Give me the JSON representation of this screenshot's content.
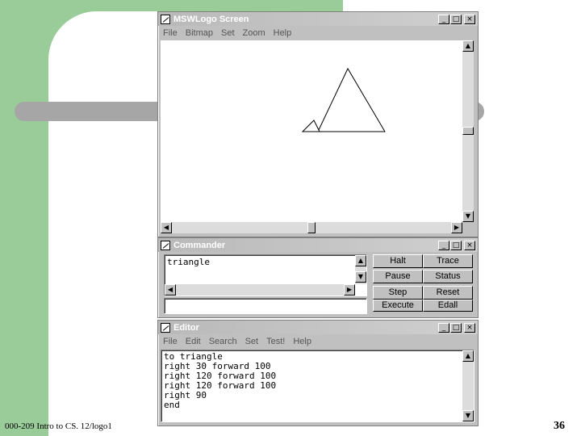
{
  "screen": {
    "title": "MSWLogo Screen",
    "menu": [
      "File",
      "Bitmap",
      "Set",
      "Zoom",
      "Help"
    ]
  },
  "commander": {
    "title": "Commander",
    "input_text": "triangle",
    "buttons": [
      "Halt",
      "Trace",
      "Pause",
      "Status",
      "Step",
      "Reset",
      "Execute",
      "Edall"
    ]
  },
  "editor": {
    "title": "Editor",
    "menu": [
      "File",
      "Edit",
      "Search",
      "Set",
      "Test!",
      "Help"
    ],
    "lines": [
      "to triangle",
      "right 30 forward 100",
      "right 120 forward 100",
      "right 120 forward 100",
      "right 90",
      "end"
    ]
  },
  "window_buttons": {
    "minimize": "_",
    "maximize": "□",
    "close": "×"
  },
  "footer": {
    "course": "000-209 Intro to CS. 12/logo1",
    "page": "36"
  }
}
